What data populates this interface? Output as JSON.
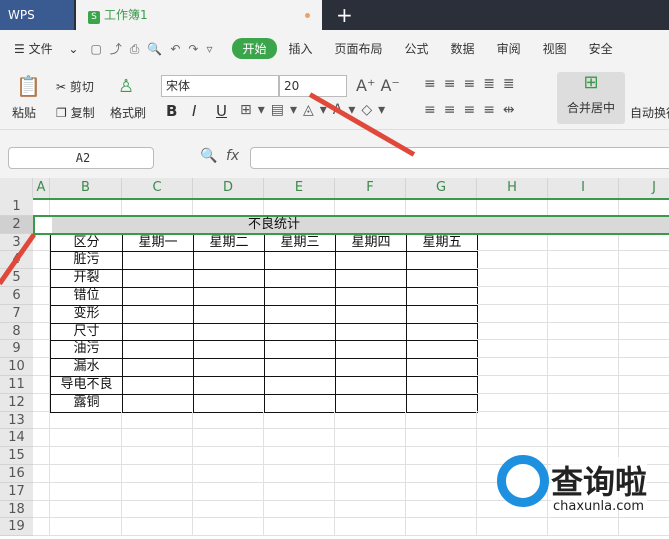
{
  "titlebar": {
    "app": "WPS",
    "doc_tab": "工作簿1",
    "new_tab": "+"
  },
  "menu": {
    "file": "文件",
    "tabs": [
      "开始",
      "插入",
      "页面布局",
      "公式",
      "数据",
      "审阅",
      "视图",
      "安全"
    ]
  },
  "ribbon": {
    "paste": "粘贴",
    "cut": "剪切",
    "copy": "复制",
    "format_painter": "格式刷",
    "font_name": "宋体",
    "font_size": "20",
    "bold": "B",
    "italic": "I",
    "underline": "U",
    "merge_center": "合并居中",
    "wrap": "自动换行"
  },
  "formula_bar": {
    "cell_ref": "A2",
    "fx": "fx",
    "value": ""
  },
  "columns": [
    "A",
    "B",
    "C",
    "D",
    "E",
    "F",
    "G",
    "H",
    "I",
    "J"
  ],
  "rows": [
    "1",
    "2",
    "3",
    "4",
    "5",
    "6",
    "7",
    "8",
    "9",
    "10",
    "11",
    "12",
    "13",
    "14",
    "15",
    "16",
    "17",
    "18",
    "19"
  ],
  "sheet": {
    "title": "不良统计",
    "header": [
      "区分",
      "星期一",
      "星期二",
      "星期三",
      "星期四",
      "星期五"
    ],
    "categories": [
      "脏污",
      "开裂",
      "错位",
      "变形",
      "尺寸",
      "油污",
      "漏水",
      "导电不良",
      "露铜"
    ]
  },
  "selection_color": "#3a9a4a",
  "watermark": {
    "text": "查询啦",
    "url": "chaxunla.com"
  }
}
